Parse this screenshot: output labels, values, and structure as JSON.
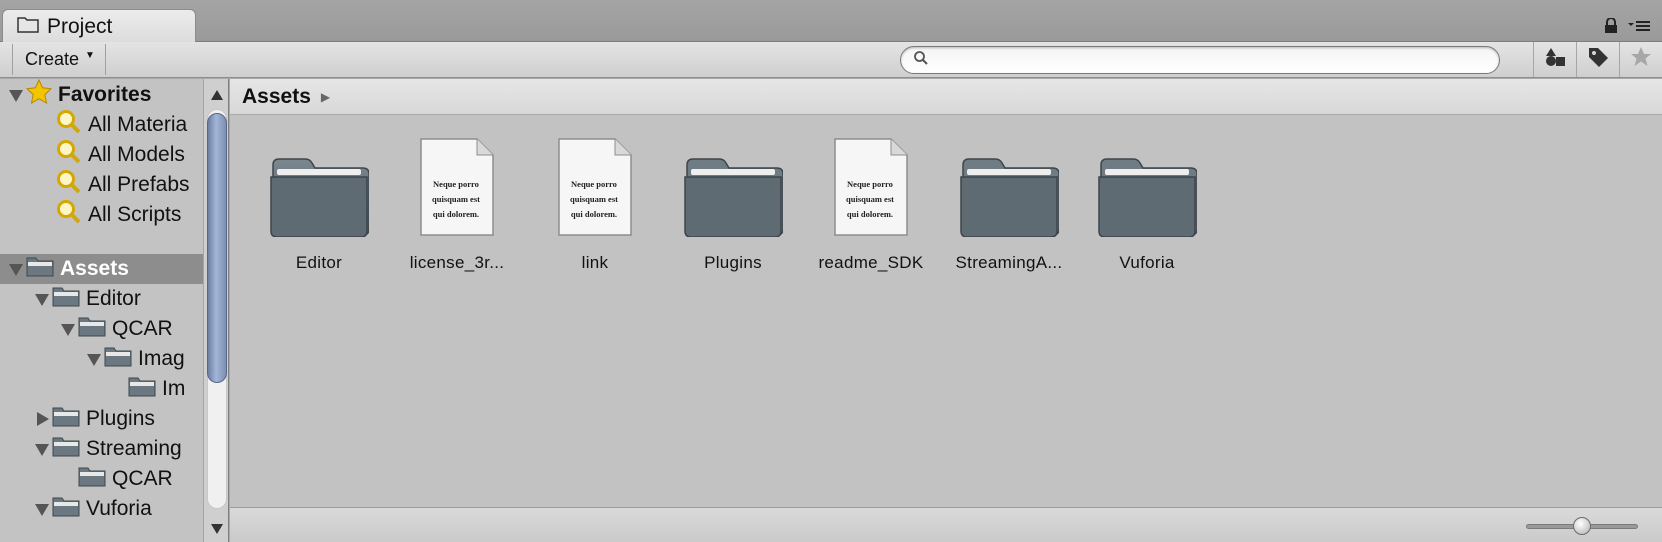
{
  "window": {
    "tab_title": "Project"
  },
  "toolbar": {
    "create_label": "Create",
    "search_value": "",
    "search_placeholder": ""
  },
  "sidebar": {
    "favorites_label": "Favorites",
    "favorites": [
      {
        "label": "All Materia"
      },
      {
        "label": "All Models"
      },
      {
        "label": "All Prefabs"
      },
      {
        "label": "All Scripts"
      }
    ],
    "tree": [
      {
        "label": "Assets",
        "selected": true
      },
      {
        "label": "Editor"
      },
      {
        "label": "QCAR"
      },
      {
        "label": "Imag"
      },
      {
        "label": "Im"
      },
      {
        "label": "Plugins"
      },
      {
        "label": "Streaming"
      },
      {
        "label": "QCAR"
      },
      {
        "label": "Vuforia"
      }
    ]
  },
  "main": {
    "breadcrumb": "Assets",
    "items": [
      {
        "label": "Editor",
        "kind": "folder"
      },
      {
        "label": "license_3r...",
        "kind": "document"
      },
      {
        "label": "link",
        "kind": "document"
      },
      {
        "label": "Plugins",
        "kind": "folder"
      },
      {
        "label": "readme_SDK",
        "kind": "document"
      },
      {
        "label": "StreamingA...",
        "kind": "folder"
      },
      {
        "label": "Vuforia",
        "kind": "folder"
      }
    ],
    "doc_preview_text": "Neque porro quisquam est qui dolorem."
  },
  "zoom": {
    "level": 0.5
  },
  "colors": {
    "selection": "#8d8d8d",
    "scroll_thumb": "#8799bb",
    "folder": "#5b6870"
  }
}
